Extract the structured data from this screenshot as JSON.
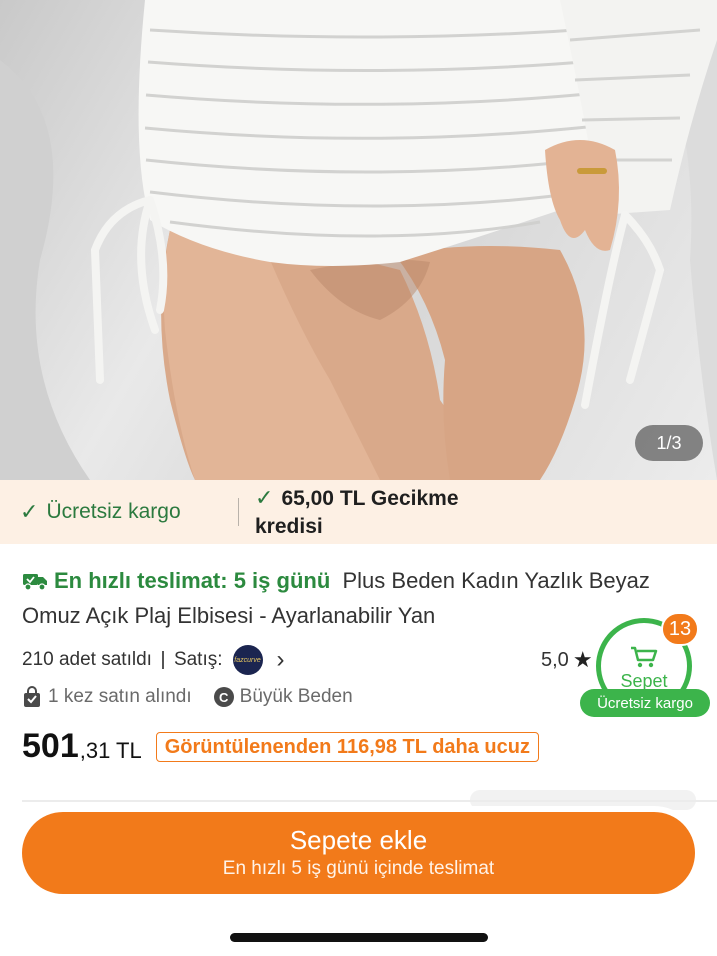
{
  "product_image": {
    "counter": "1/3",
    "alt": "white knit mini dress with side drawstrings"
  },
  "cargo_bar": {
    "free_shipping": "Ücretsiz kargo",
    "delay_credit": "65,00 TL Gecikme kredisi"
  },
  "product": {
    "fast_delivery": "En hızlı teslimat: 5 iş günü",
    "title": "Plus Beden Kadın Yazlık Beyaz Omuz Açık Plaj Elbisesi - Ayarlanabilir Yan",
    "sold_count": "210 adet satıldı",
    "seller_label": "Satış:",
    "seller_logo_text": "fazcurve",
    "rating": "5,0",
    "bought_times": "1 kez satın alındı",
    "category_badge_letter": "C",
    "category": "Büyük Beden",
    "price_main": "501",
    "price_decimal": ",31 TL",
    "cheaper_note": "Görüntülenenden 116,98 TL daha ucuz"
  },
  "cart_float": {
    "label": "Sepet",
    "count": "13",
    "free_shipping": "Ücretsiz kargo",
    "accent_color": "#3cb44b",
    "badge_color": "#f27a1a"
  },
  "add_to_cart": {
    "label": "Sepete ekle",
    "sub_label": "En hızlı 5 iş günü içinde teslimat",
    "color": "#f27a1a"
  }
}
